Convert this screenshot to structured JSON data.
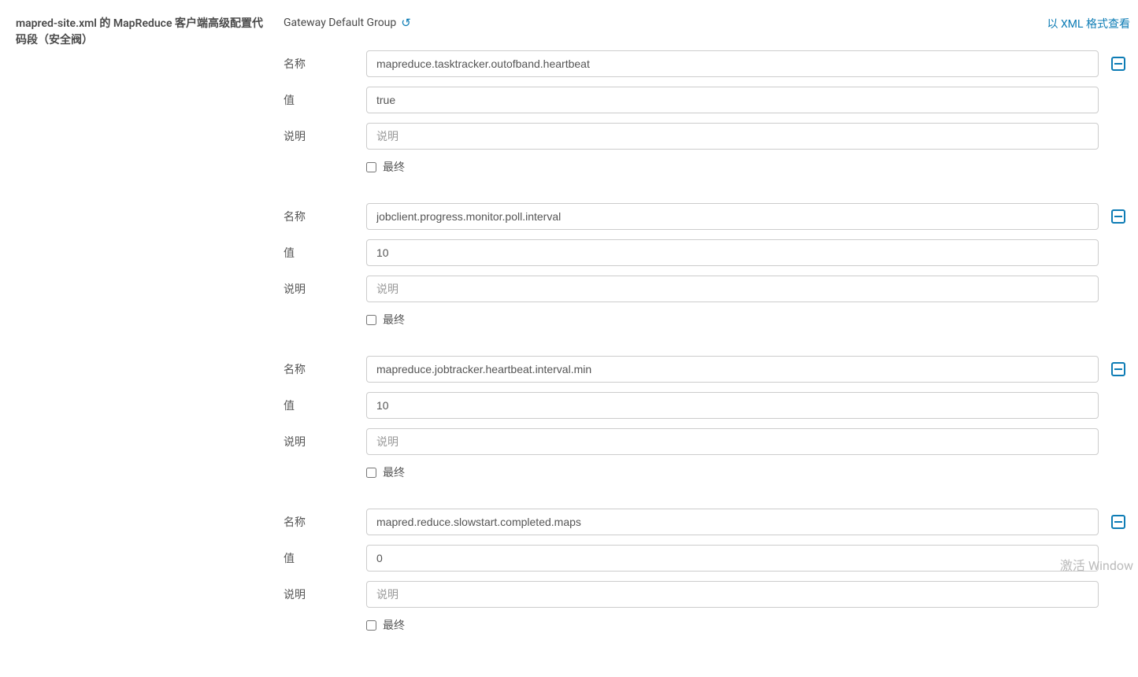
{
  "left": {
    "title": "mapred-site.xml 的 MapReduce 客户端高级配置代码段（安全阀）"
  },
  "header": {
    "group_label": "Gateway Default Group",
    "xml_link": "以 XML 格式查看"
  },
  "labels": {
    "name": "名称",
    "value": "值",
    "description": "说明",
    "final": "最终",
    "description_placeholder": "说明"
  },
  "entries": [
    {
      "name": "mapreduce.tasktracker.outofband.heartbeat",
      "value": "true",
      "description": "",
      "final": false
    },
    {
      "name": "jobclient.progress.monitor.poll.interval",
      "value": "10",
      "description": "",
      "final": false
    },
    {
      "name": "mapreduce.jobtracker.heartbeat.interval.min",
      "value": "10",
      "description": "",
      "final": false
    },
    {
      "name": "mapred.reduce.slowstart.completed.maps",
      "value": "0",
      "description": "",
      "final": false
    }
  ],
  "watermark": "激活 Window"
}
